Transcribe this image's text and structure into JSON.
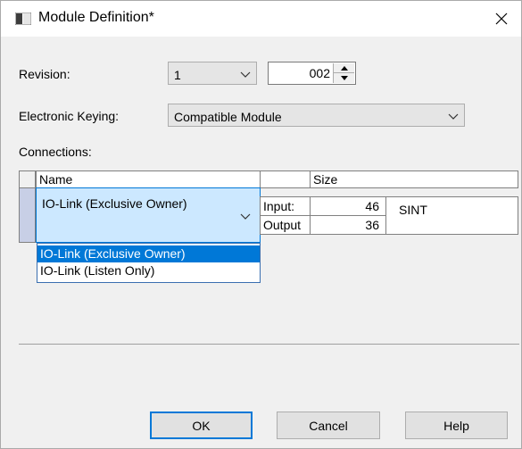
{
  "window": {
    "title": "Module Definition*",
    "close_symbol": "✕"
  },
  "revision": {
    "label": "Revision:",
    "major_value": "1",
    "minor_value": "002"
  },
  "keying": {
    "label": "Electronic Keying:",
    "value": "Compatible Module"
  },
  "connections": {
    "label": "Connections:",
    "headers": {
      "name": "Name",
      "size": "Size"
    },
    "row": {
      "name": "IO-Link (Exclusive Owner)",
      "input_label": "Input:",
      "input_value": "46",
      "output_label": "Output",
      "output_value": "36",
      "type": "SINT"
    },
    "dropdown_options": [
      "IO-Link (Exclusive Owner)",
      "IO-Link (Listen Only)"
    ]
  },
  "buttons": {
    "ok": "OK",
    "cancel": "Cancel",
    "help": "Help"
  },
  "colors": {
    "accent": "#0078d7",
    "row_selector": "#c8cfe6",
    "combo_bg": "#e5e5e5"
  }
}
